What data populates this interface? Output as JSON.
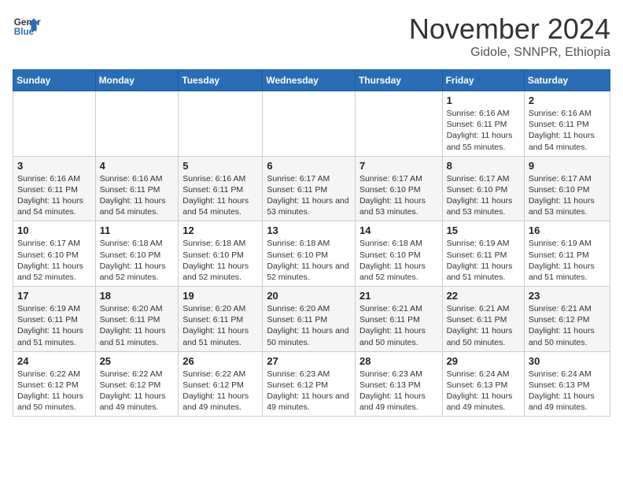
{
  "logo": {
    "line1": "General",
    "line2": "Blue"
  },
  "title": "November 2024",
  "location": "Gidole, SNNPR, Ethiopia",
  "weekdays": [
    "Sunday",
    "Monday",
    "Tuesday",
    "Wednesday",
    "Thursday",
    "Friday",
    "Saturday"
  ],
  "weeks": [
    [
      {
        "day": "",
        "info": ""
      },
      {
        "day": "",
        "info": ""
      },
      {
        "day": "",
        "info": ""
      },
      {
        "day": "",
        "info": ""
      },
      {
        "day": "",
        "info": ""
      },
      {
        "day": "1",
        "info": "Sunrise: 6:16 AM\nSunset: 6:11 PM\nDaylight: 11 hours and 55 minutes."
      },
      {
        "day": "2",
        "info": "Sunrise: 6:16 AM\nSunset: 6:11 PM\nDaylight: 11 hours and 54 minutes."
      }
    ],
    [
      {
        "day": "3",
        "info": "Sunrise: 6:16 AM\nSunset: 6:11 PM\nDaylight: 11 hours and 54 minutes."
      },
      {
        "day": "4",
        "info": "Sunrise: 6:16 AM\nSunset: 6:11 PM\nDaylight: 11 hours and 54 minutes."
      },
      {
        "day": "5",
        "info": "Sunrise: 6:16 AM\nSunset: 6:11 PM\nDaylight: 11 hours and 54 minutes."
      },
      {
        "day": "6",
        "info": "Sunrise: 6:17 AM\nSunset: 6:11 PM\nDaylight: 11 hours and 53 minutes."
      },
      {
        "day": "7",
        "info": "Sunrise: 6:17 AM\nSunset: 6:10 PM\nDaylight: 11 hours and 53 minutes."
      },
      {
        "day": "8",
        "info": "Sunrise: 6:17 AM\nSunset: 6:10 PM\nDaylight: 11 hours and 53 minutes."
      },
      {
        "day": "9",
        "info": "Sunrise: 6:17 AM\nSunset: 6:10 PM\nDaylight: 11 hours and 53 minutes."
      }
    ],
    [
      {
        "day": "10",
        "info": "Sunrise: 6:17 AM\nSunset: 6:10 PM\nDaylight: 11 hours and 52 minutes."
      },
      {
        "day": "11",
        "info": "Sunrise: 6:18 AM\nSunset: 6:10 PM\nDaylight: 11 hours and 52 minutes."
      },
      {
        "day": "12",
        "info": "Sunrise: 6:18 AM\nSunset: 6:10 PM\nDaylight: 11 hours and 52 minutes."
      },
      {
        "day": "13",
        "info": "Sunrise: 6:18 AM\nSunset: 6:10 PM\nDaylight: 11 hours and 52 minutes."
      },
      {
        "day": "14",
        "info": "Sunrise: 6:18 AM\nSunset: 6:10 PM\nDaylight: 11 hours and 52 minutes."
      },
      {
        "day": "15",
        "info": "Sunrise: 6:19 AM\nSunset: 6:11 PM\nDaylight: 11 hours and 51 minutes."
      },
      {
        "day": "16",
        "info": "Sunrise: 6:19 AM\nSunset: 6:11 PM\nDaylight: 11 hours and 51 minutes."
      }
    ],
    [
      {
        "day": "17",
        "info": "Sunrise: 6:19 AM\nSunset: 6:11 PM\nDaylight: 11 hours and 51 minutes."
      },
      {
        "day": "18",
        "info": "Sunrise: 6:20 AM\nSunset: 6:11 PM\nDaylight: 11 hours and 51 minutes."
      },
      {
        "day": "19",
        "info": "Sunrise: 6:20 AM\nSunset: 6:11 PM\nDaylight: 11 hours and 51 minutes."
      },
      {
        "day": "20",
        "info": "Sunrise: 6:20 AM\nSunset: 6:11 PM\nDaylight: 11 hours and 50 minutes."
      },
      {
        "day": "21",
        "info": "Sunrise: 6:21 AM\nSunset: 6:11 PM\nDaylight: 11 hours and 50 minutes."
      },
      {
        "day": "22",
        "info": "Sunrise: 6:21 AM\nSunset: 6:11 PM\nDaylight: 11 hours and 50 minutes."
      },
      {
        "day": "23",
        "info": "Sunrise: 6:21 AM\nSunset: 6:12 PM\nDaylight: 11 hours and 50 minutes."
      }
    ],
    [
      {
        "day": "24",
        "info": "Sunrise: 6:22 AM\nSunset: 6:12 PM\nDaylight: 11 hours and 50 minutes."
      },
      {
        "day": "25",
        "info": "Sunrise: 6:22 AM\nSunset: 6:12 PM\nDaylight: 11 hours and 49 minutes."
      },
      {
        "day": "26",
        "info": "Sunrise: 6:22 AM\nSunset: 6:12 PM\nDaylight: 11 hours and 49 minutes."
      },
      {
        "day": "27",
        "info": "Sunrise: 6:23 AM\nSunset: 6:12 PM\nDaylight: 11 hours and 49 minutes."
      },
      {
        "day": "28",
        "info": "Sunrise: 6:23 AM\nSunset: 6:13 PM\nDaylight: 11 hours and 49 minutes."
      },
      {
        "day": "29",
        "info": "Sunrise: 6:24 AM\nSunset: 6:13 PM\nDaylight: 11 hours and 49 minutes."
      },
      {
        "day": "30",
        "info": "Sunrise: 6:24 AM\nSunset: 6:13 PM\nDaylight: 11 hours and 49 minutes."
      }
    ]
  ]
}
